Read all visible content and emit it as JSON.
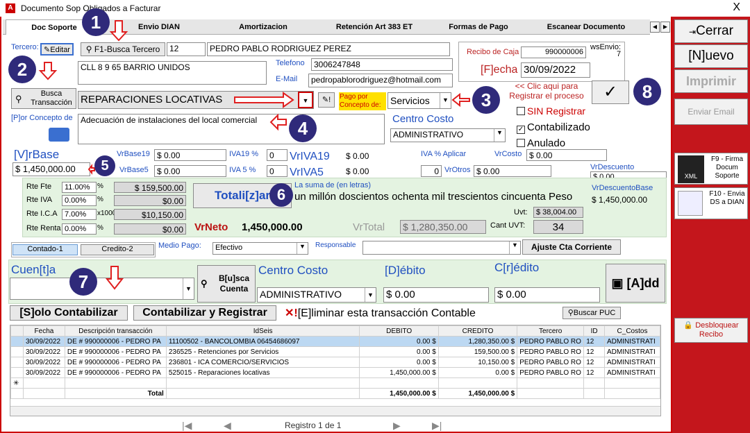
{
  "window": {
    "title": "Documento Sop    Obligados a Facturar",
    "close": "X"
  },
  "tabs": [
    "Doc Soporte",
    "Envio DIAN",
    "Amortizacion",
    "Retención Art 383 ET",
    "Formas de Pago",
    "Escanear Documento"
  ],
  "tercero": {
    "label": "Tercero:",
    "editar": "Editar",
    "busca": "F1-Busca Tercero",
    "id": "12",
    "nombre": "PEDRO PABLO RODRIGUEZ PEREZ",
    "direccion": "CLL 8 9 65 BARRIO UNIDOS",
    "tel_label": "Telefono",
    "telefono": "3006247848",
    "email_label": "E-Mail",
    "email": "pedropablorodriguez@hotmail.com"
  },
  "recibo": {
    "label": "Recibo de Caja",
    "value": "990000006",
    "ws_label": "wsEnvio:",
    "ws_value": "7",
    "fecha_label": "[F]echa",
    "fecha": "30/09/2022"
  },
  "busca_trans": "Busca Transacción",
  "transaccion": "REPARACIONES LOCATIVAS",
  "pago": {
    "label": "Pago por Concepto de:",
    "value": "Servicios",
    "hint": "<< Clic aqui para Registrar el proceso",
    "check": "✓"
  },
  "estado": {
    "sin": "SIN Registrar",
    "contab": "Contabilizado",
    "anulado": "Anulado"
  },
  "concepto": {
    "label": "[P]or Concepto de",
    "value": "Adecuación de instalaciones del local comercial"
  },
  "centro": {
    "label": "Centro Costo",
    "value": "ADMINISTRATIVO"
  },
  "vrbase": {
    "label": "[V]rBase",
    "value": "$ 1,450,000.00"
  },
  "base19": {
    "label": "VrBase19",
    "value": "$ 0.00",
    "iva_lbl": "IVA19 %",
    "iva": "0",
    "vriva_lbl": "VrIVA19",
    "vriva": "$ 0.00"
  },
  "base5": {
    "label": "VrBase5",
    "value": "$ 0.00",
    "iva_lbl": "IVA 5 %",
    "iva": "0",
    "vriva_lbl": "VrIVA5",
    "vriva": "$ 0.00"
  },
  "ivaaplicar": {
    "label": "IVA % Aplicar",
    "value": "0",
    "vrcosto_lbl": "VrCosto",
    "vrcosto": "$ 0.00",
    "vrotros_lbl": "VrOtros",
    "vrotros": "$ 0.00",
    "vrdesc_lbl": "VrDescuento",
    "vrdesc": "$ 0.00"
  },
  "ret": [
    {
      "label": "Rte Fte",
      "pct": "11.00%",
      "sym": "%",
      "value": "$ 159,500.00"
    },
    {
      "label": "Rte IVA",
      "pct": "0.00%",
      "sym": "%",
      "value": "$0.00"
    },
    {
      "label": "Rte I.C.A",
      "pct": "7.00%",
      "sym": "x1000",
      "value": "$10,150.00"
    },
    {
      "label": "Rte Renta",
      "pct": "0.00%",
      "sym": "%",
      "value": "$0.00"
    }
  ],
  "totalizar": "Totali[z]ar",
  "letras": {
    "label": "La suma de (en letras)",
    "value": "un millón doscientos ochenta mil trescientos cincuenta Peso"
  },
  "descbase": {
    "label": "VrDescuentoBase",
    "value": "$ 1,450,000.00"
  },
  "uvt": {
    "label": "Uvt:",
    "value": "$ 38,004.00",
    "cant_label": "Cant UVT:",
    "cant": "34"
  },
  "vrneto": {
    "label": "VrNeto",
    "value": "1,450,000.00"
  },
  "vrtotal": {
    "label": "VrTotal",
    "value": "$ 1,280,350.00"
  },
  "pago2": {
    "contado": "Contado-1",
    "credito": "Credito-2",
    "medio_label": "Medio Pago:",
    "medio": "Efectivo",
    "resp_label": "Responsable",
    "resp": "",
    "ajuste": "Ajuste Cta Corriente"
  },
  "cuenta": {
    "label": "Cuen[t]a",
    "busca": "B[u]sca Cuenta",
    "centro_label": "Centro Costo",
    "centro": "ADMINISTRATIVO",
    "debito_label": "[D]ébito",
    "debito": "$ 0.00",
    "credito_label": "C[r]édito",
    "credito": "$ 0.00",
    "add": "[A]dd"
  },
  "actions": {
    "solo": "[S]olo Contabilizar",
    "contab": "Contabilizar y Registrar",
    "eliminar": "[E]liminar esta transacción Contable",
    "puc": "Buscar PUC"
  },
  "grid": {
    "headers": [
      "Fecha",
      "Descripción transacción",
      "IdSeis",
      "DEBITO",
      "CREDITO",
      "Tercero",
      "ID",
      "C_Costos"
    ],
    "rows": [
      [
        "30/09/2022",
        "DE # 990000006 - PEDRO PA",
        "11100502 - BANCOLOMBIA 06454686097",
        "0.00 $",
        "1,280,350.00 $",
        "PEDRO PABLO RO",
        "12",
        "ADMINISTRATI"
      ],
      [
        "30/09/2022",
        "DE # 990000006 - PEDRO PA",
        "236525 - Retenciones por Servicios",
        "0.00 $",
        "159,500.00 $",
        "PEDRO PABLO RO",
        "12",
        "ADMINISTRATI"
      ],
      [
        "30/09/2022",
        "DE # 990000006 - PEDRO PA",
        "236801 - ICA COMERCIO/SERVICIOS",
        "0.00 $",
        "10,150.00 $",
        "PEDRO PABLO RO",
        "12",
        "ADMINISTRATI"
      ],
      [
        "30/09/2022",
        "DE # 990000006 - PEDRO PA",
        "525015 - Reparaciones locativas",
        "1,450,000.00 $",
        "0.00 $",
        "PEDRO PABLO RO",
        "12",
        "ADMINISTRATI"
      ]
    ],
    "total_label": "Total",
    "total_debito": "1,450,000.00 $",
    "total_credito": "1,450,000.00 $"
  },
  "registro": "Registro 1 de 1",
  "sidebar": {
    "cerrar": "Cerrar",
    "nuevo": "[N]uevo",
    "imprimir": "Imprimir",
    "email": "Enviar Email",
    "f9": "F9 - Firma Docum Soporte",
    "f10": "F10 - Envia DS a DIAN",
    "xml": "XML",
    "desbloquear": "Desbloquear Recibo"
  },
  "callouts": [
    "1",
    "2",
    "3",
    "4",
    "5",
    "6",
    "7",
    "8"
  ],
  "colors": {
    "accent": "#2f2a7a",
    "sidebar": "#c4161c",
    "label_blue": "#1f4fc0"
  }
}
